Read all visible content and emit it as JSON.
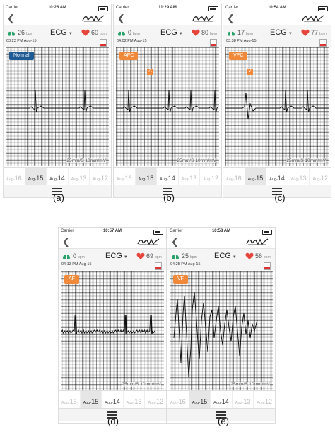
{
  "screens": [
    {
      "status": {
        "carrier": "Carrier",
        "time": "10:26 AM"
      },
      "vitals": {
        "rr": "26",
        "rr_unit": "bpm",
        "mode": "ECG",
        "hr": "60",
        "hr_unit": "bpm",
        "date": "03:23 PM Aug-15"
      },
      "tag": "Normal",
      "marker": "",
      "scale": "25mm/S 10mm/mV",
      "caption": "(a)",
      "dates": [
        {
          "p": "Aug-",
          "n": "16"
        },
        {
          "p": "Aug-",
          "n": "15"
        },
        {
          "p": "Aug-",
          "n": "14"
        },
        {
          "p": "Aug-",
          "n": "13"
        },
        {
          "p": "Aug-",
          "n": "12"
        }
      ]
    },
    {
      "status": {
        "carrier": "Carrier",
        "time": "11:29 AM"
      },
      "vitals": {
        "rr": "0",
        "rr_unit": "bpm",
        "mode": "ECG",
        "hr": "80",
        "hr_unit": "bpm",
        "date": "04:02 PM Aug-15"
      },
      "tag": "APC",
      "marker": "A",
      "scale": "25mm/S 10mm/mV",
      "caption": "(b)",
      "dates": [
        {
          "p": "Aug-",
          "n": "16"
        },
        {
          "p": "Aug-",
          "n": "15"
        },
        {
          "p": "Aug-",
          "n": "14"
        },
        {
          "p": "Aug-",
          "n": "13"
        },
        {
          "p": "Aug-",
          "n": "12"
        }
      ]
    },
    {
      "status": {
        "carrier": "Carrier",
        "time": "10:54 AM"
      },
      "vitals": {
        "rr": "17",
        "rr_unit": "bpm",
        "mode": "ECG",
        "hr": "77",
        "hr_unit": "bpm",
        "date": "03:38 PM Aug-15"
      },
      "tag": "VPC",
      "marker": "V",
      "scale": "25mm/S 10mm/mV",
      "caption": "(c)",
      "dates": [
        {
          "p": "Aug-",
          "n": "16"
        },
        {
          "p": "Aug-",
          "n": "15"
        },
        {
          "p": "Aug-",
          "n": "14"
        },
        {
          "p": "Aug-",
          "n": "13"
        },
        {
          "p": "Aug-",
          "n": "12"
        }
      ]
    },
    {
      "status": {
        "carrier": "Carrier",
        "time": "10:57 AM"
      },
      "vitals": {
        "rr": "0",
        "rr_unit": "bpm",
        "mode": "ECG",
        "hr": "69",
        "hr_unit": "bpm",
        "date": "04:13 PM Aug-15"
      },
      "tag": "AF",
      "marker": "",
      "scale": "25mm/S 10mm/mV",
      "caption": "(d)",
      "dates": [
        {
          "p": "Aug-",
          "n": "16"
        },
        {
          "p": "Aug-",
          "n": "15"
        },
        {
          "p": "Aug-",
          "n": "14"
        },
        {
          "p": "Aug-",
          "n": "13"
        },
        {
          "p": "Aug-",
          "n": "12"
        }
      ]
    },
    {
      "status": {
        "carrier": "Carrier",
        "time": "10:58 AM"
      },
      "vitals": {
        "rr": "25",
        "rr_unit": "bpm",
        "mode": "ECG",
        "hr": "56",
        "hr_unit": "bpm",
        "date": "04:25 PM Aug-15"
      },
      "tag": "VF",
      "marker": "",
      "scale": "25mm/S 10mm/mV",
      "caption": "(e)",
      "dates": [
        {
          "p": "Aug-",
          "n": "16"
        },
        {
          "p": "Aug-",
          "n": "15"
        },
        {
          "p": "Aug-",
          "n": "14"
        },
        {
          "p": "Aug-",
          "n": "13"
        },
        {
          "p": "Aug-",
          "n": "12"
        }
      ]
    }
  ],
  "colors": {
    "tag_normal": "#1e5a94",
    "tag_alert": "#f08a3a",
    "heart": "#e6453b",
    "lung": "#2aa36a",
    "selected_date_bg": "#e6e6e6"
  },
  "icons": [
    "back-chevron-icon",
    "brand-logo",
    "lung-icon",
    "heart-icon",
    "pdf-export-icon",
    "hamburger-menu-icon"
  ]
}
